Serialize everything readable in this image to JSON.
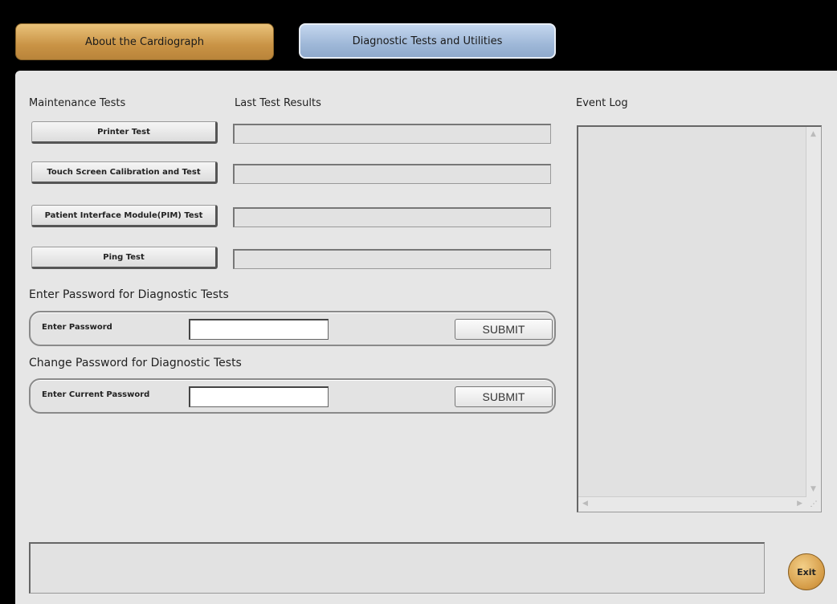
{
  "tabs": {
    "about": "About the Cardiograph",
    "diagnostic": "Diagnostic Tests and Utilities"
  },
  "headers": {
    "maintenance": "Maintenance Tests",
    "last_results": "Last Test Results",
    "event_log": "Event Log"
  },
  "tests": [
    {
      "label": "Printer Test",
      "result": ""
    },
    {
      "label": "Touch Screen Calibration and Test",
      "result": ""
    },
    {
      "label": "Patient Interface Module(PIM) Test",
      "result": ""
    },
    {
      "label": "Ping Test",
      "result": ""
    }
  ],
  "enter_password": {
    "title": "Enter Password for Diagnostic Tests",
    "field_label": "Enter Password",
    "value": "",
    "submit": "SUBMIT"
  },
  "change_password": {
    "title": "Change Password for Diagnostic Tests",
    "field_label": "Enter Current Password",
    "value": "",
    "submit": "SUBMIT"
  },
  "exit_label": "Exit",
  "colors": {
    "about_tab": "#c99345",
    "diagnostic_tab": "#9fb8d8",
    "panel": "#e6e6e6",
    "exit_button": "#d49a45"
  }
}
